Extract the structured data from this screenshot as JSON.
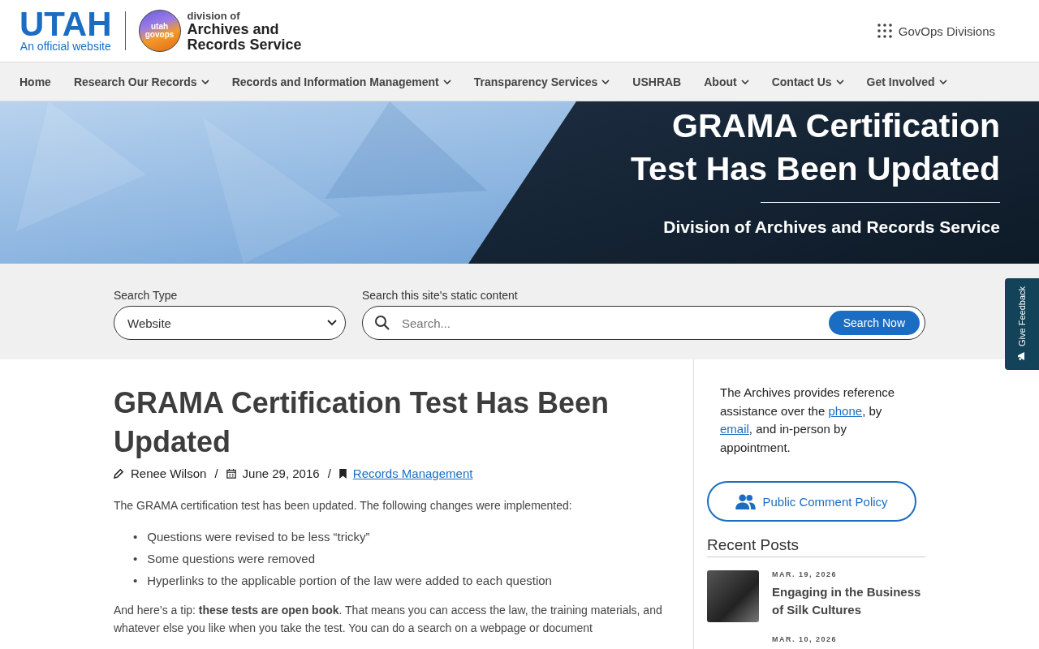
{
  "header": {
    "state_logo": "UTAH",
    "state_tagline": "An official website",
    "badge_text": [
      "utah",
      "govops"
    ],
    "division_of": "division of",
    "division_name": [
      "Archives and",
      "Records Service"
    ],
    "divisions_link": "GovOps Divisions"
  },
  "nav": [
    {
      "label": "Home",
      "dropdown": false
    },
    {
      "label": "Research Our Records",
      "dropdown": true
    },
    {
      "label": "Records and Information Management",
      "dropdown": true
    },
    {
      "label": "Transparency Services",
      "dropdown": true
    },
    {
      "label": "USHRAB",
      "dropdown": false
    },
    {
      "label": "About",
      "dropdown": true
    },
    {
      "label": "Contact Us",
      "dropdown": true
    },
    {
      "label": "Get Involved",
      "dropdown": true
    }
  ],
  "hero": {
    "title": [
      "GRAMA Certification",
      "Test Has Been Updated"
    ],
    "subtitle": "Division of Archives and Records Service"
  },
  "search": {
    "type_label": "Search Type",
    "type_value": "Website",
    "field_label": "Search this site's static content",
    "placeholder": "Search...",
    "button": "Search Now"
  },
  "feedback_tab": "Give Feedback",
  "article": {
    "title": "GRAMA Certification Test Has Been Updated",
    "author": "Renee Wilson",
    "separator": [
      "/",
      "/"
    ],
    "date": "June 29, 2016",
    "category": "Records Management",
    "intro": "The GRAMA certification test has been updated. The following changes were implemented:",
    "bullet_marker": "•",
    "bullets": [
      "Questions were revised to be less “tricky”",
      "Some questions were removed",
      "Hyperlinks to the applicable portion of the law were added to each question"
    ],
    "tip": "And here’s a tip: **these tests are open book**. That means you can access the law, the training materials, and whatever else you like when you take the test. You can do a search on a webpage or document"
  },
  "sidebar": {
    "info": [
      {
        "kind": "text",
        "text": "The Archives provides reference assistance over the "
      },
      {
        "kind": "link",
        "text": "phone"
      },
      {
        "kind": "text",
        "text": ", by "
      },
      {
        "kind": "link",
        "text": "email"
      },
      {
        "kind": "text",
        "text": ", and in-person by appointment."
      }
    ],
    "policy_button": "Public Comment Policy",
    "recent_heading": "Recent Posts",
    "posts": [
      {
        "date": "MAR. 19, 2026",
        "title": "Engaging in the Business of Silk Cultures",
        "thumbnail": true
      },
      {
        "date": "MAR. 10, 2026",
        "thumbnail": false
      }
    ]
  }
}
